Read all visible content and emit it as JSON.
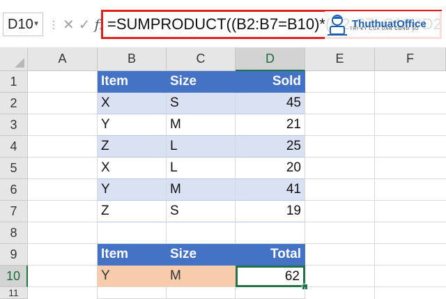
{
  "name_box": "D10",
  "formula": "=SUMPRODUCT((B2:B7=B10)*(C2:C7=C10)*D2:D7)",
  "logo": {
    "name": "ThuthuatOffice",
    "tagline": "TRI KY CUA DAN CONG SO"
  },
  "columns": [
    "A",
    "B",
    "C",
    "D",
    "E",
    "F"
  ],
  "rows": [
    "1",
    "2",
    "3",
    "4",
    "5",
    "6",
    "7",
    "8",
    "9",
    "10",
    "11"
  ],
  "table1": {
    "headers": [
      "Item",
      "Size",
      "Sold"
    ],
    "rows": [
      [
        "X",
        "S",
        "45"
      ],
      [
        "Y",
        "M",
        "21"
      ],
      [
        "Z",
        "L",
        "25"
      ],
      [
        "X",
        "L",
        "20"
      ],
      [
        "Y",
        "M",
        "41"
      ],
      [
        "Z",
        "S",
        "19"
      ]
    ]
  },
  "table2": {
    "headers": [
      "Item",
      "Size",
      "Total"
    ],
    "row": [
      "Y",
      "M",
      "62"
    ]
  },
  "colors": {
    "header_blue": "#4472c4",
    "band_blue": "#d9e1f2",
    "criteria_orange": "#f8cbad",
    "selection_green": "#217346",
    "highlight_red": "#e02020"
  }
}
